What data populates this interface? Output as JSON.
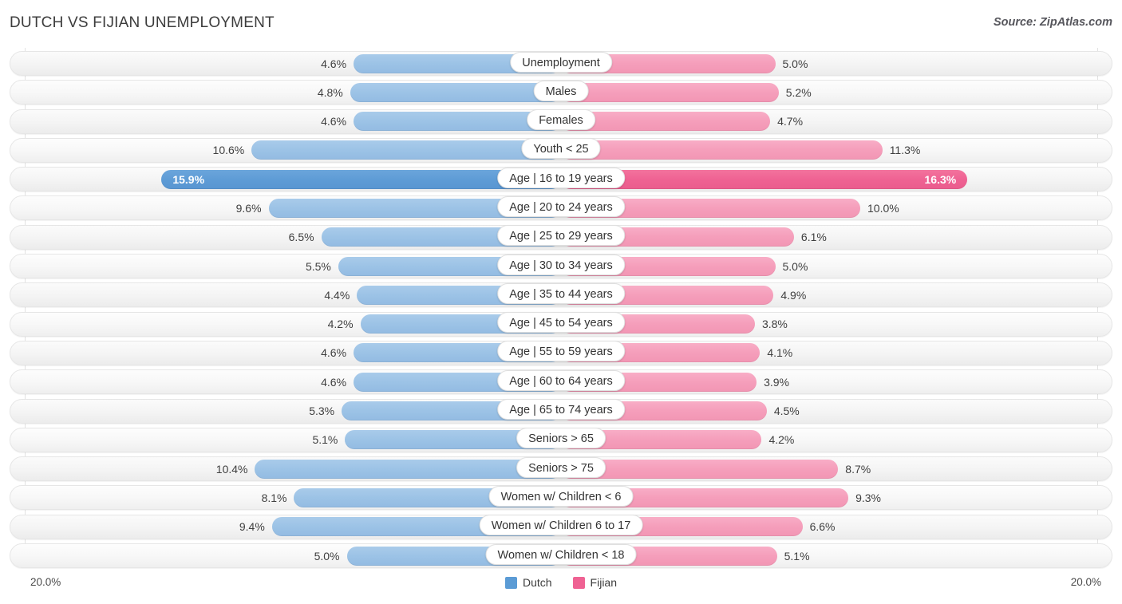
{
  "header": {
    "title": "DUTCH VS FIJIAN UNEMPLOYMENT",
    "source": "Source: ZipAtlas.com"
  },
  "axis": {
    "left_label": "20.0%",
    "right_label": "20.0%",
    "max": 20.0
  },
  "legend": {
    "items": [
      {
        "label": "Dutch",
        "color": "#5b9bd5"
      },
      {
        "label": "Fijian",
        "color": "#ef6293"
      }
    ]
  },
  "colors": {
    "dutch_light": "#9cc3e6",
    "dutch_dark": "#5e9cd6",
    "fijian_light": "#f59ebb",
    "fijian_dark": "#ef6293",
    "track": "#f4f4f4",
    "text": "#3f3f3f"
  },
  "chart_data": {
    "type": "bar",
    "subtype": "butterfly",
    "title": "DUTCH VS FIJIAN UNEMPLOYMENT",
    "xlabel": "",
    "ylabel": "",
    "xlim": [
      0,
      20.0
    ],
    "grid": true,
    "legend_position": "bottom-center",
    "categories": [
      "Unemployment",
      "Males",
      "Females",
      "Youth < 25",
      "Age | 16 to 19 years",
      "Age | 20 to 24 years",
      "Age | 25 to 29 years",
      "Age | 30 to 34 years",
      "Age | 35 to 44 years",
      "Age | 45 to 54 years",
      "Age | 55 to 59 years",
      "Age | 60 to 64 years",
      "Age | 65 to 74 years",
      "Seniors > 65",
      "Seniors > 75",
      "Women w/ Children < 6",
      "Women w/ Children 6 to 17",
      "Women w/ Children < 18"
    ],
    "series": [
      {
        "name": "Dutch",
        "color": "#9cc3e6",
        "values": [
          4.6,
          4.8,
          4.6,
          10.6,
          15.9,
          9.6,
          6.5,
          5.5,
          4.4,
          4.2,
          4.6,
          4.6,
          5.3,
          5.1,
          10.4,
          8.1,
          9.4,
          5.0
        ]
      },
      {
        "name": "Fijian",
        "color": "#f59ebb",
        "values": [
          5.0,
          5.2,
          4.7,
          11.3,
          16.3,
          10.0,
          6.1,
          5.0,
          4.9,
          3.8,
          4.1,
          3.9,
          4.5,
          4.2,
          8.7,
          9.3,
          6.6,
          5.1
        ]
      }
    ],
    "highlighted_row_index": 4
  },
  "rows": [
    {
      "label": "Unemployment",
      "left_value": "4.6%",
      "right_value": "5.0%",
      "left": 4.6,
      "right": 5.0,
      "highlight": false
    },
    {
      "label": "Males",
      "left_value": "4.8%",
      "right_value": "5.2%",
      "left": 4.8,
      "right": 5.2,
      "highlight": false
    },
    {
      "label": "Females",
      "left_value": "4.6%",
      "right_value": "4.7%",
      "left": 4.6,
      "right": 4.7,
      "highlight": false
    },
    {
      "label": "Youth < 25",
      "left_value": "10.6%",
      "right_value": "11.3%",
      "left": 10.6,
      "right": 11.3,
      "highlight": false
    },
    {
      "label": "Age | 16 to 19 years",
      "left_value": "15.9%",
      "right_value": "16.3%",
      "left": 15.9,
      "right": 16.3,
      "highlight": true
    },
    {
      "label": "Age | 20 to 24 years",
      "left_value": "9.6%",
      "right_value": "10.0%",
      "left": 9.6,
      "right": 10.0,
      "highlight": false
    },
    {
      "label": "Age | 25 to 29 years",
      "left_value": "6.5%",
      "right_value": "6.1%",
      "left": 6.5,
      "right": 6.1,
      "highlight": false
    },
    {
      "label": "Age | 30 to 34 years",
      "left_value": "5.5%",
      "right_value": "5.0%",
      "left": 5.5,
      "right": 5.0,
      "highlight": false
    },
    {
      "label": "Age | 35 to 44 years",
      "left_value": "4.4%",
      "right_value": "4.9%",
      "left": 4.4,
      "right": 4.9,
      "highlight": false
    },
    {
      "label": "Age | 45 to 54 years",
      "left_value": "4.2%",
      "right_value": "3.8%",
      "left": 4.2,
      "right": 3.8,
      "highlight": false
    },
    {
      "label": "Age | 55 to 59 years",
      "left_value": "4.6%",
      "right_value": "4.1%",
      "left": 4.6,
      "right": 4.1,
      "highlight": false
    },
    {
      "label": "Age | 60 to 64 years",
      "left_value": "4.6%",
      "right_value": "3.9%",
      "left": 4.6,
      "right": 3.9,
      "highlight": false
    },
    {
      "label": "Age | 65 to 74 years",
      "left_value": "5.3%",
      "right_value": "4.5%",
      "left": 5.3,
      "right": 4.5,
      "highlight": false
    },
    {
      "label": "Seniors > 65",
      "left_value": "5.1%",
      "right_value": "4.2%",
      "left": 5.1,
      "right": 4.2,
      "highlight": false
    },
    {
      "label": "Seniors > 75",
      "left_value": "10.4%",
      "right_value": "8.7%",
      "left": 10.4,
      "right": 8.7,
      "highlight": false
    },
    {
      "label": "Women w/ Children < 6",
      "left_value": "8.1%",
      "right_value": "9.3%",
      "left": 8.1,
      "right": 9.3,
      "highlight": false
    },
    {
      "label": "Women w/ Children 6 to 17",
      "left_value": "9.4%",
      "right_value": "6.6%",
      "left": 9.4,
      "right": 6.6,
      "highlight": false
    },
    {
      "label": "Women w/ Children < 18",
      "left_value": "5.0%",
      "right_value": "5.1%",
      "left": 5.0,
      "right": 5.1,
      "highlight": false
    }
  ]
}
